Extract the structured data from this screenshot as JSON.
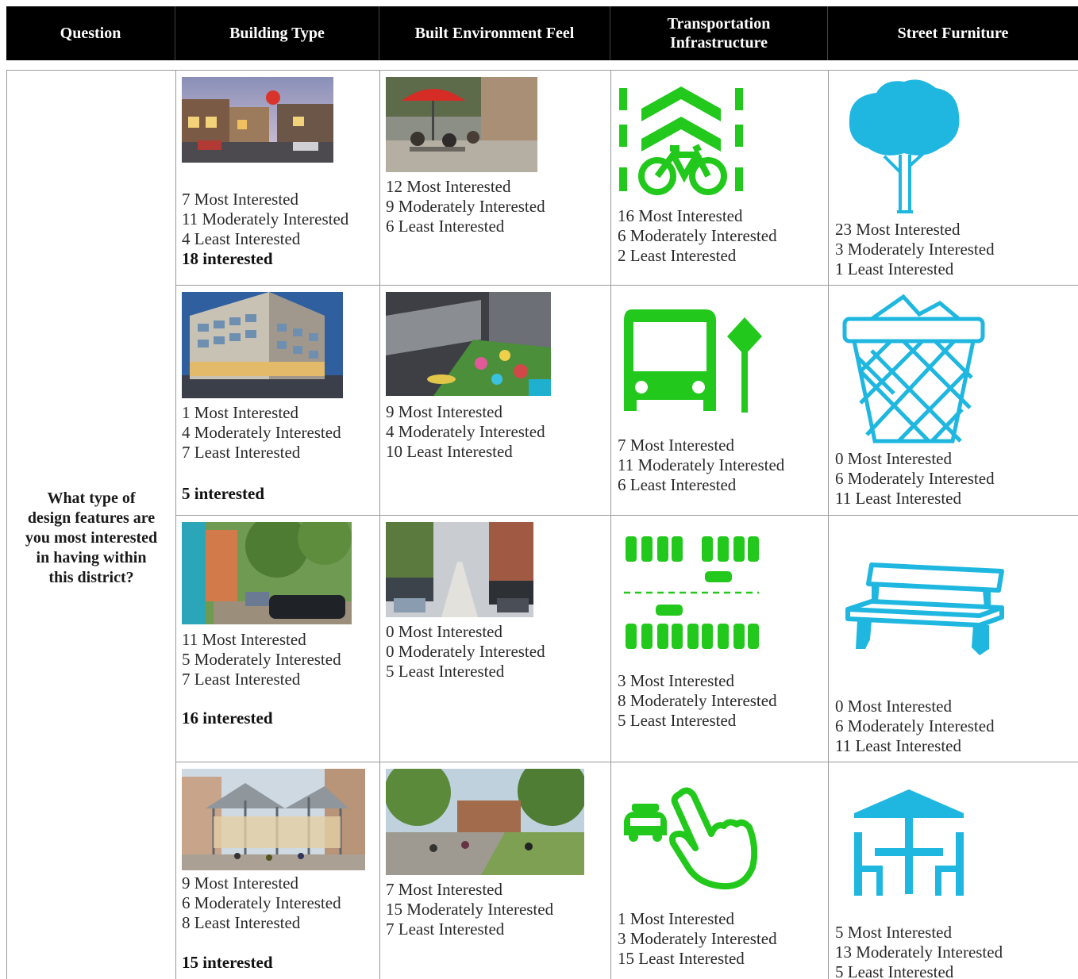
{
  "header": {
    "question": "Question",
    "building_type": "Building Type",
    "built_environment": "Built Environment Feel",
    "transportation_line1": "Transportation",
    "transportation_line2": "Infrastructure",
    "street_furniture": "Street Furniture"
  },
  "question_lines": [
    "What type of",
    "design features are",
    "you most interested",
    "in having within",
    "this district?"
  ],
  "colors": {
    "transport_icon": "#22c91c",
    "furniture_icon": "#1fb7e0",
    "header_bg": "#000000"
  },
  "icons": {
    "transport": [
      "bike-lane-icon",
      "bus-stop-icon",
      "parking-lot-icon",
      "ride-hail-icon"
    ],
    "furniture": [
      "tree-icon",
      "trash-can-icon",
      "bench-icon",
      "picnic-table-icon"
    ]
  },
  "rows": [
    {
      "building": {
        "most": "7 Most Interested",
        "moderate": "11 Moderately Interested",
        "least": "4 Least Interested",
        "total": "18 interested"
      },
      "environment": {
        "most": "12 Most Interested",
        "moderate": "9 Moderately Interested",
        "least": "6 Least Interested"
      },
      "transport": {
        "most": "16 Most Interested",
        "moderate": "6 Moderately Interested",
        "least": "2 Least Interested"
      },
      "furniture": {
        "most": "23 Most Interested",
        "moderate": "3 Moderately Interested",
        "least": "1 Least Interested"
      }
    },
    {
      "building": {
        "most": "1 Most Interested",
        "moderate": "4 Moderately Interested",
        "least": "7 Least Interested",
        "total": "5 interested"
      },
      "environment": {
        "most": "9 Most Interested",
        "moderate": "4 Moderately Interested",
        "least": "10 Least Interested"
      },
      "transport": {
        "most": "7 Most Interested",
        "moderate": "11 Moderately Interested",
        "least": "6 Least Interested"
      },
      "furniture": {
        "most": "0 Most Interested",
        "moderate": "6 Moderately Interested",
        "least": "11 Least Interested"
      }
    },
    {
      "building": {
        "most": "11 Most Interested",
        "moderate": "5 Moderately Interested",
        "least": "7 Least Interested",
        "total": "16 interested"
      },
      "environment": {
        "most": "0 Most Interested",
        "moderate": "0 Moderately Interested",
        "least": "5 Least Interested"
      },
      "transport": {
        "most": "3 Most Interested",
        "moderate": "8 Moderately Interested",
        "least": "5 Least Interested"
      },
      "furniture": {
        "most": "0 Most Interested",
        "moderate": "6 Moderately Interested",
        "least": "11 Least Interested"
      }
    },
    {
      "building": {
        "most": "9 Most Interested",
        "moderate": "6 Moderately Interested",
        "least": "8 Least Interested",
        "total": "15 interested"
      },
      "environment": {
        "most": "7 Most Interested",
        "moderate": "15 Moderately Interested",
        "least": "7 Least Interested"
      },
      "transport": {
        "most": "1 Most Interested",
        "moderate": "3 Moderately Interested",
        "least": "15 Least Interested"
      },
      "furniture": {
        "most": "5 Most Interested",
        "moderate": "13 Moderately Interested",
        "least": "5 Least Interested"
      }
    }
  ]
}
